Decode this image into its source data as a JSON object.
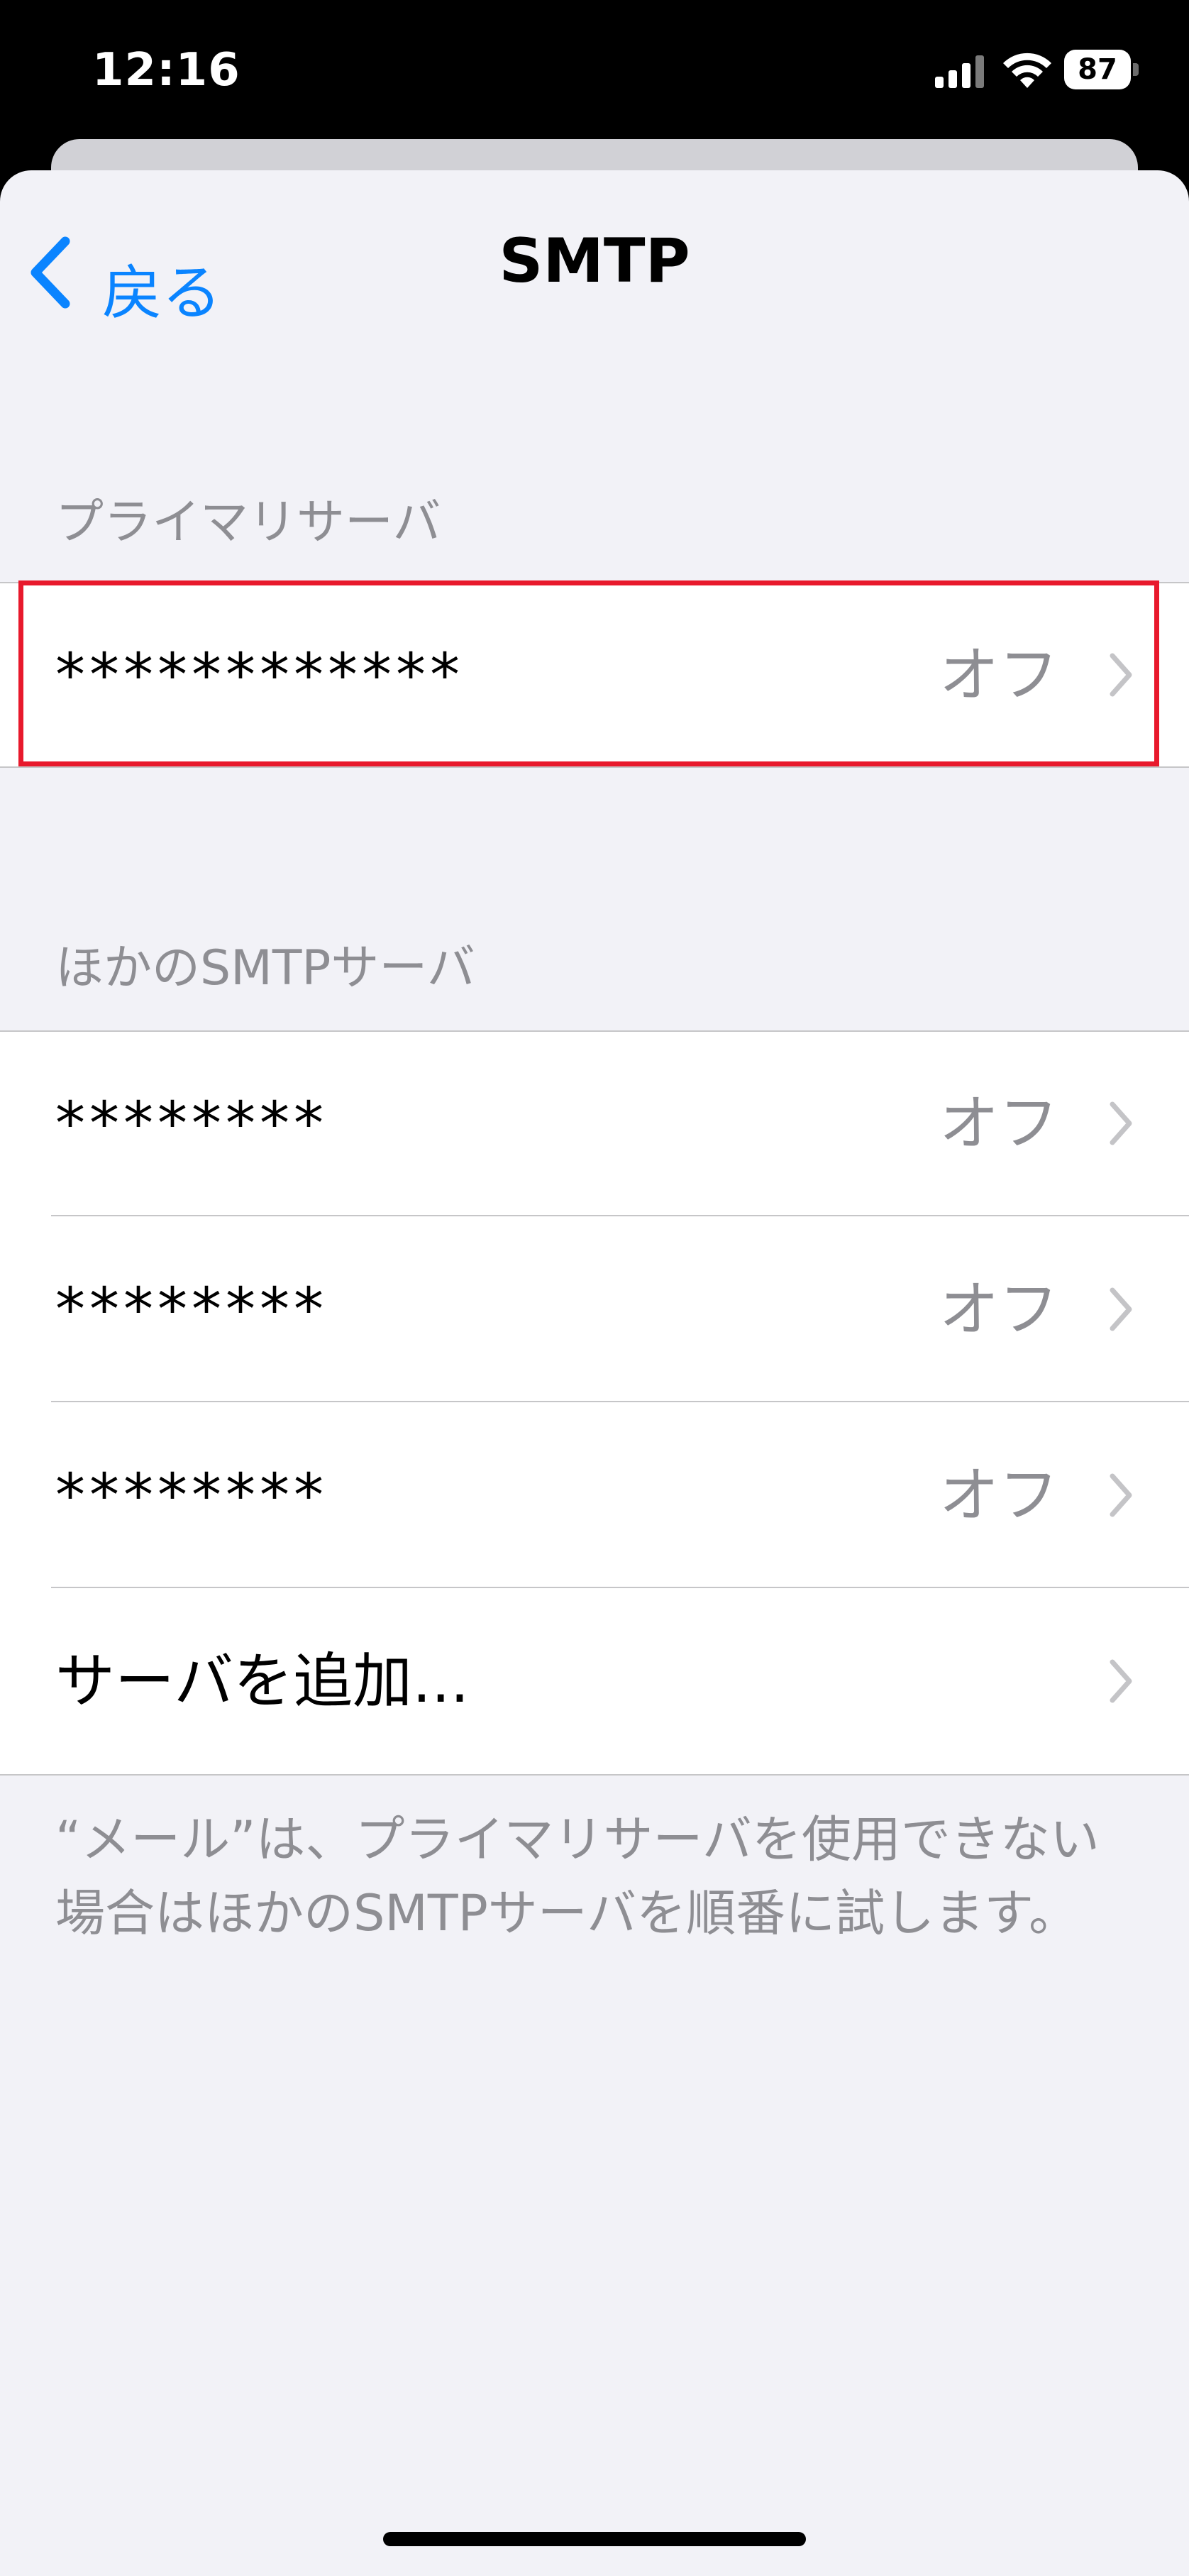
{
  "status_bar": {
    "time": "12:16",
    "battery": "87"
  },
  "nav": {
    "back_label": "戻る",
    "title": "SMTP"
  },
  "primary_section": {
    "header": "プライマリサーバ",
    "rows": [
      {
        "label": "************",
        "value": "オフ"
      }
    ]
  },
  "other_section": {
    "header": "ほかのSMTPサーバ",
    "rows": [
      {
        "label": "********",
        "value": "オフ"
      },
      {
        "label": "********",
        "value": "オフ"
      },
      {
        "label": "********",
        "value": "オフ"
      }
    ],
    "add_server": "サーバを追加..."
  },
  "footer": "“メール”は、プライマリサーバを使用できない場合はほかのSMTPサーバを順番に試します。",
  "colors": {
    "accent": "#0a84ff",
    "highlight": "#e8192c",
    "secondary_text": "#8e8e93",
    "background": "#f2f2f7"
  },
  "icons": [
    "signal-icon",
    "wifi-icon",
    "battery-icon",
    "back-chevron-icon",
    "chevron-right-icon"
  ]
}
